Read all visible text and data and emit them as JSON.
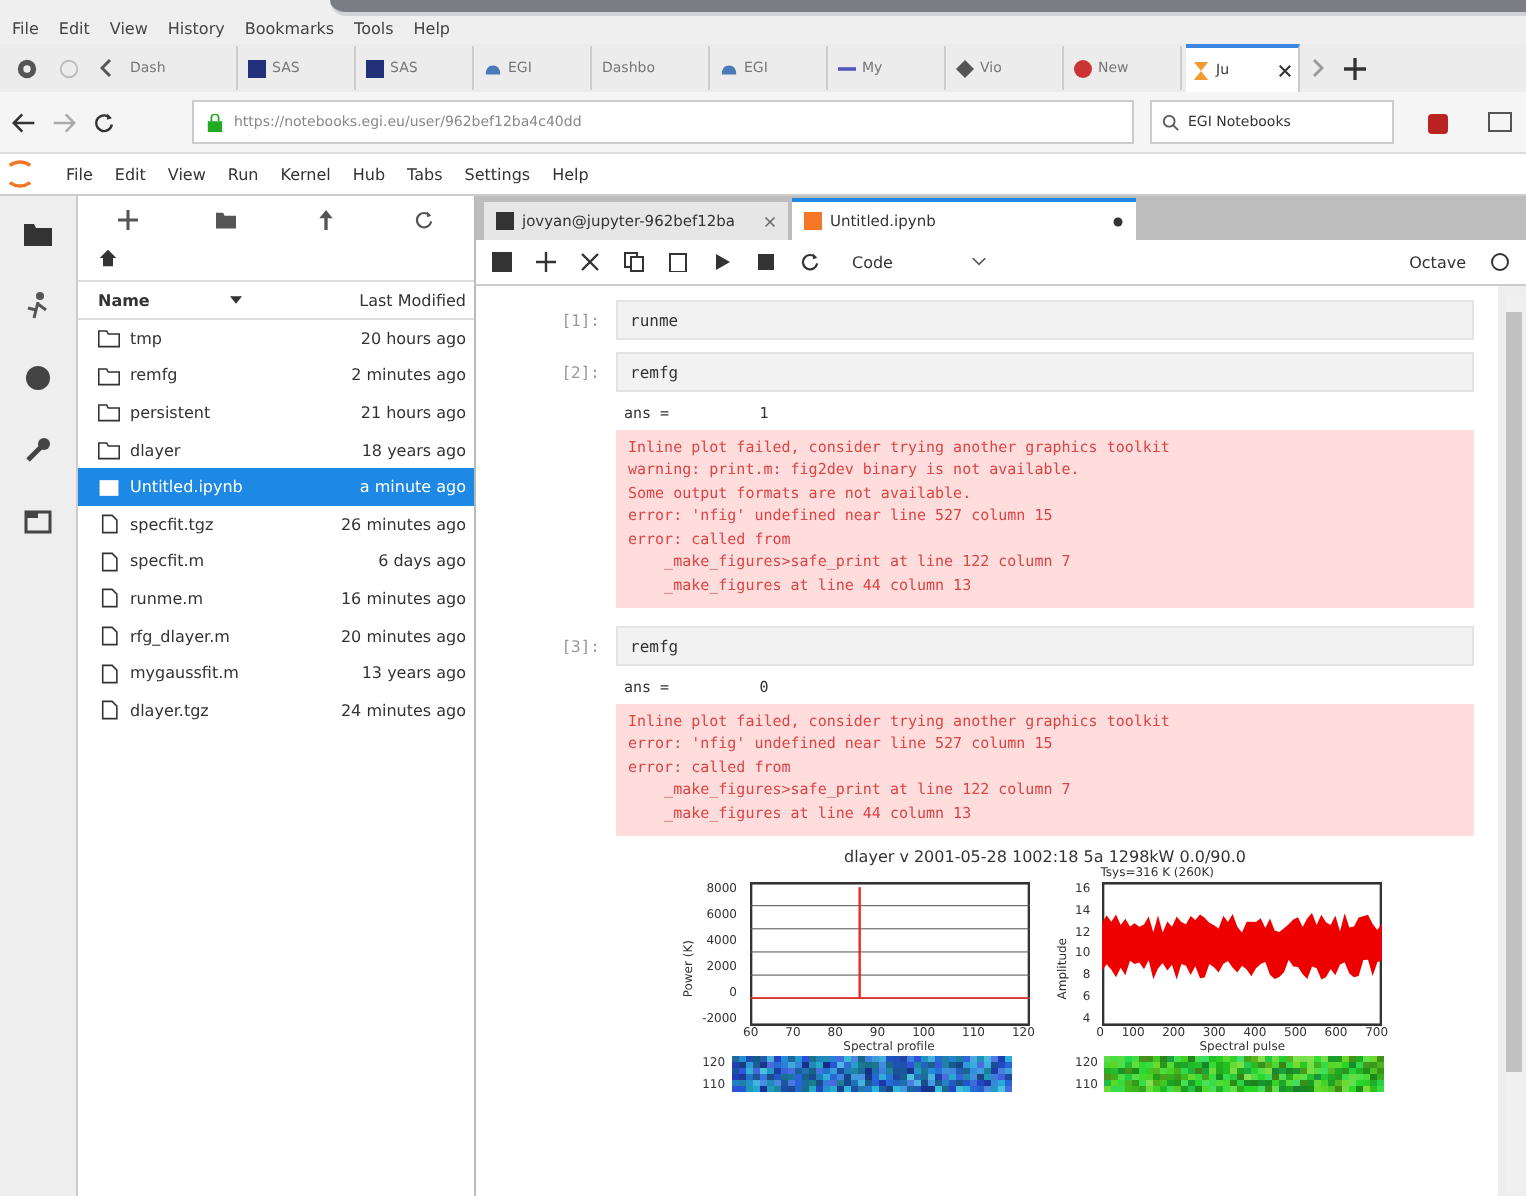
{
  "browser_menu": [
    "File",
    "Edit",
    "View",
    "History",
    "Bookmarks",
    "Tools",
    "Help"
  ],
  "browser_tabs": [
    {
      "label": "Dash",
      "selected": false,
      "kind": "plain"
    },
    {
      "label": "SAS",
      "selected": false,
      "kind": "square"
    },
    {
      "label": "SAS",
      "selected": false,
      "kind": "square"
    },
    {
      "label": "EGI",
      "selected": false,
      "kind": "cloud"
    },
    {
      "label": "Dashbo",
      "selected": false,
      "kind": "plain"
    },
    {
      "label": "EGI",
      "selected": false,
      "kind": "cloud"
    },
    {
      "label": "My",
      "selected": false,
      "kind": "bar"
    },
    {
      "label": "Vio",
      "selected": false,
      "kind": "diamond"
    },
    {
      "label": "New",
      "selected": false,
      "kind": "circle"
    },
    {
      "label": "Ju",
      "selected": true,
      "kind": "hourglass"
    }
  ],
  "address": {
    "url": "https://notebooks.egi.eu/user/962bef12ba4c40dd",
    "search": "EGI Notebooks"
  },
  "jupyter_menu": [
    "File",
    "Edit",
    "View",
    "Run",
    "Kernel",
    "Hub",
    "Tabs",
    "Settings",
    "Help"
  ],
  "file_browser": {
    "columns": [
      "Name",
      "Last Modified"
    ],
    "items": [
      {
        "kind": "folder",
        "name": "tmp",
        "modified": "20 hours ago",
        "selected": false
      },
      {
        "kind": "folder",
        "name": "remfg",
        "modified": "2 minutes ago",
        "selected": false
      },
      {
        "kind": "folder",
        "name": "persistent",
        "modified": "21 hours ago",
        "selected": false
      },
      {
        "kind": "folder",
        "name": "dlayer",
        "modified": "18 years ago",
        "selected": false
      },
      {
        "kind": "notebook",
        "name": "Untitled.ipynb",
        "modified": "a minute ago",
        "selected": true
      },
      {
        "kind": "file",
        "name": "specfit.tgz",
        "modified": "26 minutes ago",
        "selected": false
      },
      {
        "kind": "file",
        "name": "specfit.m",
        "modified": "6 days ago",
        "selected": false
      },
      {
        "kind": "file",
        "name": "runme.m",
        "modified": "16 minutes ago",
        "selected": false
      },
      {
        "kind": "file",
        "name": "rfg_dlayer.m",
        "modified": "20 minutes ago",
        "selected": false
      },
      {
        "kind": "file",
        "name": "mygaussfit.m",
        "modified": "13 years ago",
        "selected": false
      },
      {
        "kind": "file",
        "name": "dlayer.tgz",
        "modified": "24 minutes ago",
        "selected": false
      }
    ]
  },
  "doc_tabs": [
    {
      "label": "jovyan@jupyter-962bef12ba",
      "kind": "terminal",
      "selected": false
    },
    {
      "label": "Untitled.ipynb",
      "kind": "notebook",
      "selected": true
    }
  ],
  "toolbar": {
    "cell_type": "Code",
    "kernel": "Octave"
  },
  "cells": [
    {
      "prompt": "[1]:",
      "source": "runme"
    },
    {
      "prompt": "[2]:",
      "source": "remfg",
      "outputs": [
        {
          "kind": "text",
          "text": "ans =          1"
        },
        {
          "kind": "error",
          "text": "Inline plot failed, consider trying another graphics toolkit\nwarning: print.m: fig2dev binary is not available.\nSome output formats are not available.\nerror: 'nfig' undefined near line 527 column 15\nerror: called from\n    _make_figures>safe_print at line 122 column 7\n    _make_figures at line 44 column 13"
        }
      ]
    },
    {
      "prompt": "[3]:",
      "source": "remfg",
      "outputs": [
        {
          "kind": "text",
          "text": "ans =          0"
        },
        {
          "kind": "error",
          "text": "Inline plot failed, consider trying another graphics toolkit\nerror: 'nfig' undefined near line 527 column 15\nerror: called from\n    _make_figures>safe_print at line 122 column 7\n    _make_figures at line 44 column 13"
        },
        {
          "kind": "figure",
          "title": "dlayer v 2001-05-28 1002:18 5a 1298kW 0.0/90.0",
          "subtitle": "Tsys=316 K (260K)",
          "plots": [
            {
              "kind": "spike",
              "ylabel": "Power (K)",
              "xlabel": "Spectral profile",
              "yticks": [
                "8000",
                "6000",
                "4000",
                "2000",
                "0",
                "-2000"
              ],
              "xticks": [
                "60",
                "70",
                "80",
                "90",
                "100",
                "110",
                "120"
              ]
            },
            {
              "kind": "noise",
              "ylabel": "Amplitude",
              "xlabel": "Spectral pulse",
              "yticks": [
                "16",
                "14",
                "12",
                "10",
                "8",
                "6",
                "4"
              ],
              "xticks": [
                "0",
                "100",
                "200",
                "300",
                "400",
                "500",
                "600",
                "700"
              ]
            },
            {
              "kind": "heat_blue",
              "yticks": [
                "120",
                "110"
              ]
            },
            {
              "kind": "heat_green",
              "yticks": [
                "120",
                "110"
              ]
            }
          ]
        }
      ]
    }
  ]
}
